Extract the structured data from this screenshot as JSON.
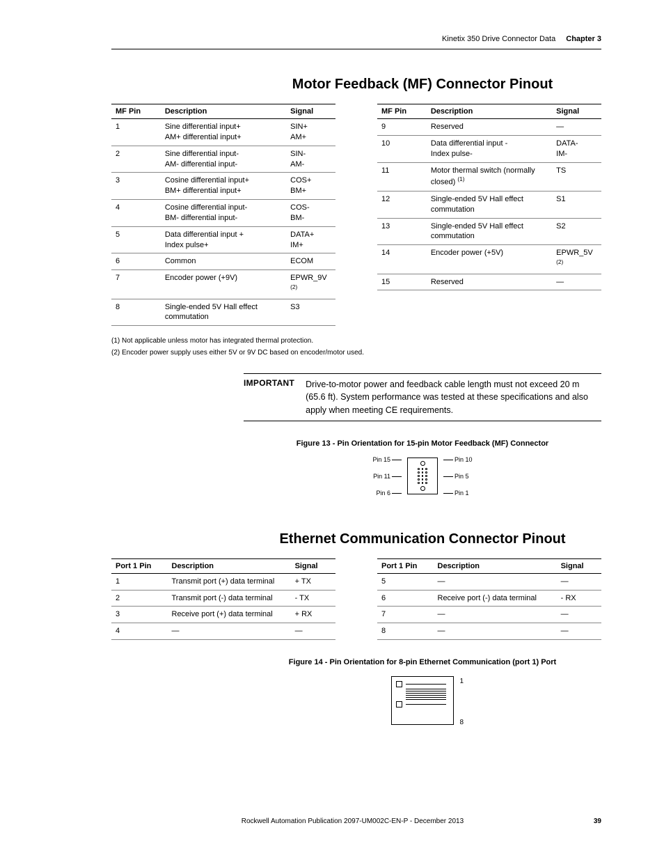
{
  "header": {
    "title": "Kinetix 350 Drive Connector Data",
    "chapter": "Chapter 3"
  },
  "section1": {
    "title": "Motor Feedback (MF) Connector Pinout",
    "headers": {
      "pin": "MF Pin",
      "desc": "Description",
      "sig": "Signal"
    },
    "left": [
      {
        "pin": "1",
        "desc": "Sine differential input+\nAM+ differential input+",
        "sig": "SIN+\nAM+"
      },
      {
        "pin": "2",
        "desc": "Sine differential input-\nAM- differential input-",
        "sig": "SIN-\nAM-"
      },
      {
        "pin": "3",
        "desc": "Cosine differential input+\nBM+ differential input+",
        "sig": "COS+\nBM+"
      },
      {
        "pin": "4",
        "desc": "Cosine differential input-\nBM- differential input-",
        "sig": "COS-\nBM-"
      },
      {
        "pin": "5",
        "desc": "Data differential input +\nIndex pulse+",
        "sig": "DATA+\nIM+"
      },
      {
        "pin": "6",
        "desc": "Common",
        "sig": "ECOM"
      },
      {
        "pin": "7",
        "desc": "Encoder power (+9V)",
        "sig": "EPWR_9V",
        "sup": "(2)"
      },
      {
        "pin": "8",
        "desc": "Single-ended 5V Hall effect commutation",
        "sig": "S3"
      }
    ],
    "right": [
      {
        "pin": "9",
        "desc": "Reserved",
        "sig": "—"
      },
      {
        "pin": "10",
        "desc": "Data differential input -\nIndex pulse-",
        "sig": "DATA-\nIM-"
      },
      {
        "pin": "11",
        "desc": "Motor thermal switch (normally closed)",
        "dsup": "(1)",
        "sig": "TS"
      },
      {
        "pin": "12",
        "desc": "Single-ended 5V Hall effect commutation",
        "sig": "S1"
      },
      {
        "pin": "13",
        "desc": "Single-ended 5V Hall effect commutation",
        "sig": "S2"
      },
      {
        "pin": "14",
        "desc": "Encoder power (+5V)",
        "sig": "EPWR_5V",
        "sup": "(2)"
      },
      {
        "pin": "15",
        "desc": "Reserved",
        "sig": "—"
      }
    ],
    "footnotes": [
      "(1)   Not applicable unless motor has integrated thermal protection.",
      "(2)   Encoder power supply uses either 5V or 9V DC based on encoder/motor used."
    ]
  },
  "important": {
    "label": "IMPORTANT",
    "text": "Drive-to-motor power and feedback cable length must not exceed 20 m (65.6 ft). System performance was tested at these specifications and also apply when meeting CE requirements."
  },
  "figure13": {
    "caption": "Figure 13 - Pin Orientation for 15-pin Motor Feedback (MF) Connector",
    "labels": {
      "p15": "Pin 15",
      "p11": "Pin 11",
      "p6": "Pin 6",
      "p10": "Pin 10",
      "p5": "Pin 5",
      "p1": "Pin 1"
    }
  },
  "section2": {
    "title": "Ethernet Communication Connector Pinout",
    "headers": {
      "pin": "Port 1 Pin",
      "desc": "Description",
      "sig": "Signal"
    },
    "left": [
      {
        "pin": "1",
        "desc": "Transmit port (+) data terminal",
        "sig": "+ TX"
      },
      {
        "pin": "2",
        "desc": "Transmit port (-) data terminal",
        "sig": "- TX"
      },
      {
        "pin": "3",
        "desc": "Receive port (+) data terminal",
        "sig": "+ RX"
      },
      {
        "pin": "4",
        "desc": "—",
        "sig": "—"
      }
    ],
    "right": [
      {
        "pin": "5",
        "desc": "—",
        "sig": "—"
      },
      {
        "pin": "6",
        "desc": "Receive port (-) data terminal",
        "sig": "- RX"
      },
      {
        "pin": "7",
        "desc": "—",
        "sig": "—"
      },
      {
        "pin": "8",
        "desc": "—",
        "sig": "—"
      }
    ]
  },
  "figure14": {
    "caption": "Figure 14 - Pin Orientation for 8-pin Ethernet Communication (port 1) Port",
    "labels": {
      "top": "1",
      "bottom": "8"
    }
  },
  "footer": {
    "pub": "Rockwell Automation Publication 2097-UM002C-EN-P - December 2013",
    "page": "39"
  }
}
